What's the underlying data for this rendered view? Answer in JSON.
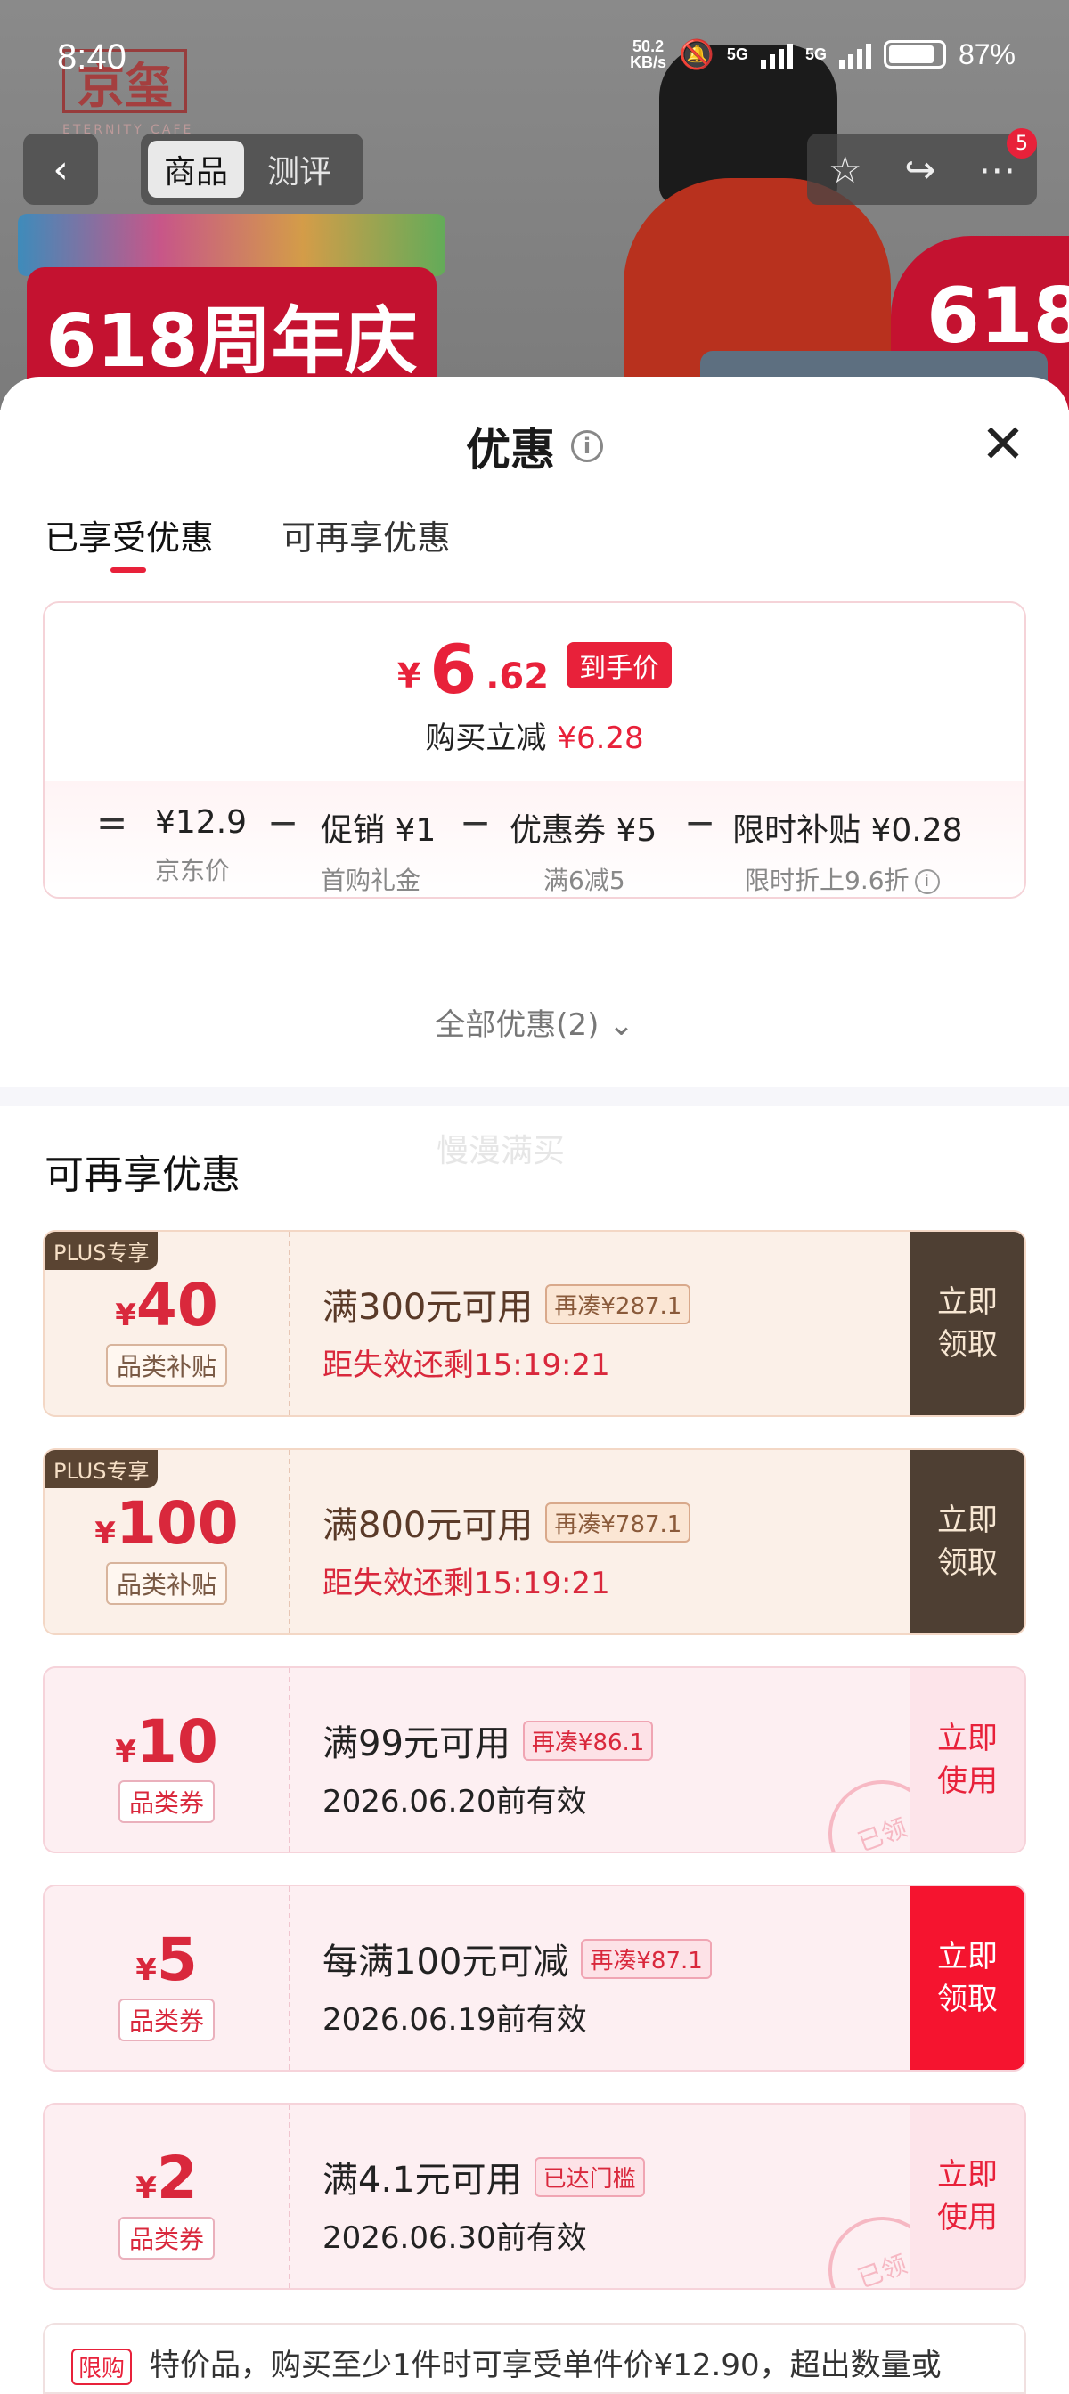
{
  "status_bar": {
    "time": "8:40",
    "net_speed_top": "50.2",
    "net_speed_bottom": "KB/s",
    "net_1": "5G",
    "net_2": "5G",
    "battery": "87%"
  },
  "background": {
    "logo": "京玺",
    "logo_sub": "ETERNITY CAFE",
    "banner": "618周年庆",
    "badge": "618"
  },
  "top_nav": {
    "back_icon": "‹",
    "tabs": [
      "商品",
      "测评"
    ],
    "active_tab": "商品",
    "more_badge": "5"
  },
  "sheet": {
    "title": "优惠",
    "close": "✕",
    "tabs": [
      {
        "label": "已享受优惠",
        "active": true
      },
      {
        "label": "可再享优惠",
        "active": false
      }
    ],
    "summary": {
      "currency": "¥",
      "price_int": "6",
      "price_dec": ".62",
      "price_tag": "到手价",
      "reduce_label": "购买立减",
      "reduce_value": "¥6.28",
      "formula": [
        {
          "op": "=",
          "value": "¥12.9",
          "sub": "京东价"
        },
        {
          "op": "−",
          "value": "促销 ¥1",
          "sub": "首购礼金\n1"
        },
        {
          "op": "−",
          "value": "优惠券 ¥5",
          "sub": "满6减5"
        },
        {
          "op": "−",
          "value": "限时补贴 ¥0.28",
          "sub": "限时折上9.6折"
        }
      ]
    },
    "all_deals": "全部优惠(2)",
    "watermark": "慢漫满买",
    "section_title": "可再享优惠",
    "coupons": [
      {
        "plus": "PLUS专享",
        "currency": "¥",
        "amount": "40",
        "type": "品类补贴",
        "cond": "满300元可用",
        "tag": "再凑¥287.1",
        "sub": "距失效还剩15:19:21",
        "btn": "立即\n领取"
      },
      {
        "plus": "PLUS专享",
        "currency": "¥",
        "amount": "100",
        "type": "品类补贴",
        "cond": "满800元可用",
        "tag": "再凑¥787.1",
        "sub": "距失效还剩15:19:21",
        "btn": "立即\n领取"
      },
      {
        "plus": "",
        "currency": "¥",
        "amount": "10",
        "type": "品类券",
        "cond": "满99元可用",
        "tag": "再凑¥86.1",
        "sub": "2026.06.20前有效",
        "btn": "立即\n使用",
        "stamp": "已领"
      },
      {
        "plus": "",
        "currency": "¥",
        "amount": "5",
        "type": "品类券",
        "cond": "每满100元可减",
        "tag": "再凑¥87.1",
        "sub": "2026.06.19前有效",
        "btn": "立即\n领取"
      },
      {
        "plus": "",
        "currency": "¥",
        "amount": "2",
        "type": "品类券",
        "cond": "满4.1元可用",
        "tag": "已达门槛",
        "sub": "2026.06.30前有效",
        "btn": "立即\n使用",
        "stamp": "已领"
      }
    ],
    "last_row": {
      "tag": "限购",
      "text": "特价品，购买至少1件时可享受单件价¥12.90，超出数量或"
    }
  }
}
